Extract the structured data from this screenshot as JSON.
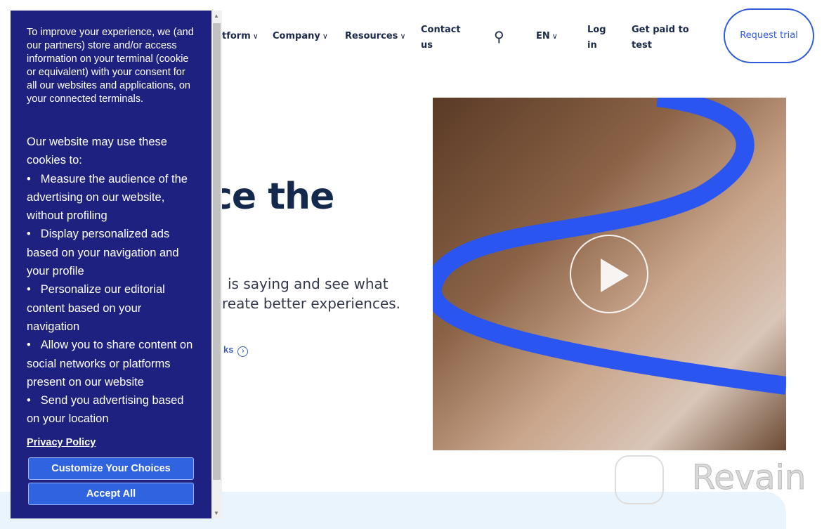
{
  "nav": {
    "items": [
      {
        "label": "tform",
        "chevron": true
      },
      {
        "label": "Company",
        "chevron": true
      },
      {
        "label": "Resources",
        "chevron": true
      },
      {
        "label": "Contact us"
      },
      {
        "label": "EN",
        "chevron": true
      },
      {
        "label": "Log in"
      },
      {
        "label": "Get paid to test"
      }
    ],
    "request_trial": "Request trial",
    "search_icon": "search-icon"
  },
  "hero": {
    "title": "ce the",
    "subtitle_line1": "is saying and see what",
    "subtitle_line2": "reate better experiences.",
    "cta": "ks"
  },
  "cookie": {
    "intro": "To improve your experience, we (and our partners) store and/or access information on your terminal (cookie or equivalent) with your consent for all our websites and applications, on your connected terminals.",
    "heading": "Our website may use these cookies to:",
    "items": [
      "Measure the audience of the advertising on our website, without profiling",
      "Display personalized ads based on your navigation and your profile",
      "Personalize our editorial content based on your navigation",
      "Allow you to share content on social networks or platforms present on our website",
      "Send you advertising based on your location"
    ],
    "privacy": "Privacy Policy",
    "customize": "Customize Your Choices",
    "accept": "Accept All"
  },
  "watermark": "Revain",
  "colors": {
    "modal_bg": "#1f2180",
    "button": "#2f63e0",
    "accent": "#2f5bd8"
  }
}
